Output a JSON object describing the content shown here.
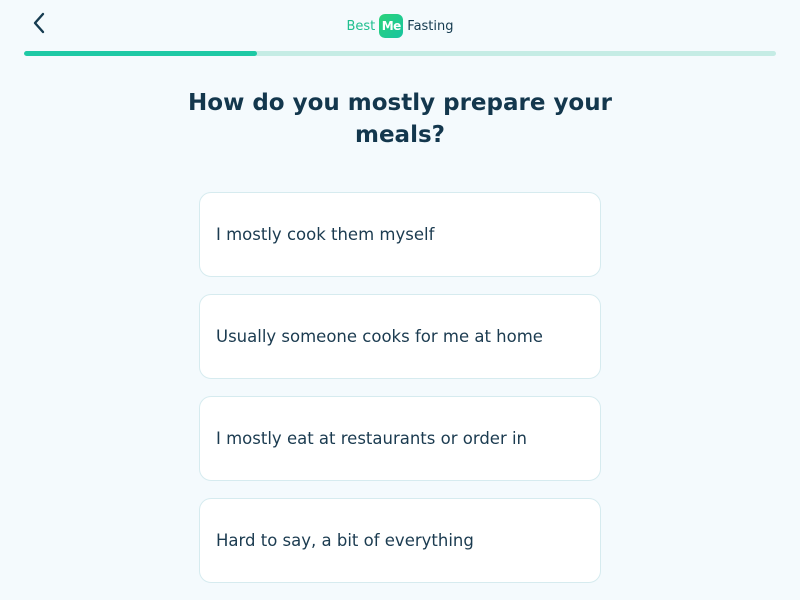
{
  "header": {
    "back_icon": "chevron-left-icon",
    "logo": {
      "left_text": "Best",
      "badge_text": "Me",
      "right_text": "Fasting"
    },
    "progress_fraction": 0.31
  },
  "question": "How do you mostly prepare your meals?",
  "options": [
    {
      "label": "I mostly cook them myself"
    },
    {
      "label": "Usually someone cooks for me at home"
    },
    {
      "label": "I mostly eat at restaurants or order in"
    },
    {
      "label": "Hard to say, a bit of everything"
    }
  ],
  "colors": {
    "accent": "#1ec9a5",
    "track": "#c5ece5",
    "title": "#13374d",
    "background": "#f4fafd"
  }
}
